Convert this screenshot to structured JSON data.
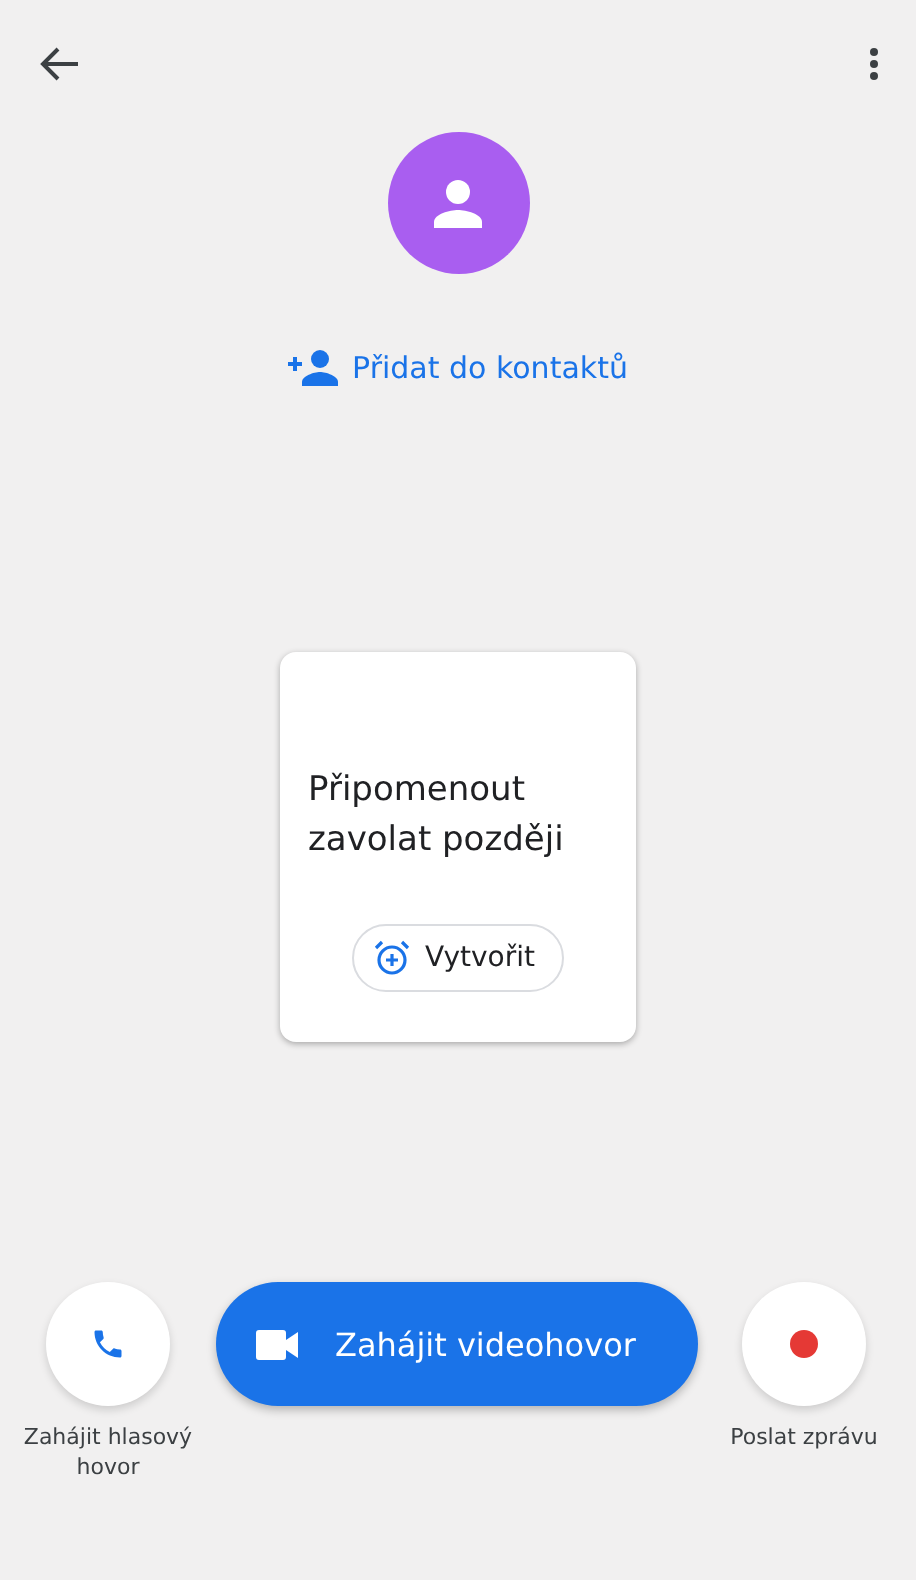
{
  "add_contact": {
    "label": "Přidat do kontaktů"
  },
  "reminder_card": {
    "title": "Připomenout zavolat později",
    "button": "Vytvořit"
  },
  "actions": [
    {
      "kind": "voice",
      "label": "Zahájit hlasový hovor"
    },
    {
      "kind": "video",
      "label": "Zahájit videohovor"
    },
    {
      "kind": "message",
      "label": "Poslat zprávu"
    }
  ]
}
